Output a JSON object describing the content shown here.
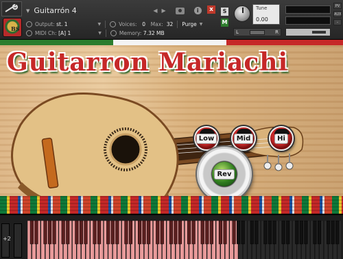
{
  "header": {
    "instrument_name": "Guitarrón 4",
    "output_label": "Output:",
    "output_value": "st. 1",
    "voices_label": "Voices:",
    "voices_value": "0",
    "max_label": "Max:",
    "max_value": "32",
    "purge_label": "Purge",
    "midi_label": "MIDI Ch:",
    "midi_value": "[A] 1",
    "memory_label": "Memory:",
    "memory_value": "7.32 MB",
    "solo_label": "S",
    "mute_label": "M",
    "tune_label": "Tune",
    "tune_value": "0.00",
    "left_label": "L",
    "right_label": "R",
    "info_label": "i",
    "close_label": "x",
    "pv_label": "PV",
    "aux_label": "AUX",
    "logo_text": "BS"
  },
  "gui": {
    "title": "Guitarron Mariachi",
    "knob_low": "Low",
    "knob_mid": "Mid",
    "knob_hi": "Hi",
    "knob_rev": "Rev"
  },
  "keyboard": {
    "octave_label": "+2"
  },
  "colors": {
    "mexico_green": "#2a7d2e",
    "mexico_red": "#c62828",
    "key_pink": "#e89a9a"
  }
}
